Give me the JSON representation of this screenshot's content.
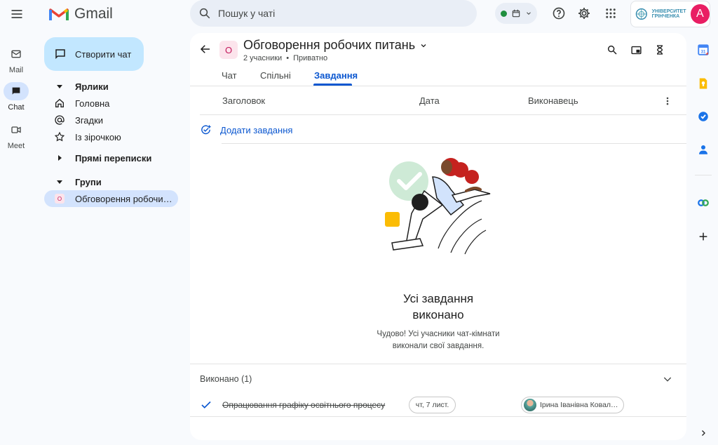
{
  "header": {
    "app_name": "Gmail",
    "search_placeholder": "Пошук у чаті",
    "account_org": "УНІВЕРСИТЕТ ГРІНЧЕНКА",
    "avatar_letter": "A",
    "status_color": "#1e8e3e"
  },
  "rail": {
    "mail": "Mail",
    "chat": "Chat",
    "meet": "Meet"
  },
  "nav": {
    "new_chat": "Створити чат",
    "labels_section": "Ярлики",
    "home": "Головна",
    "mentions": "Згадки",
    "starred": "Із зірочкою",
    "direct_section": "Прямі переписки",
    "groups_section": "Групи",
    "group_item": "Обговорення робочи…",
    "group_item_initial": "О"
  },
  "space": {
    "initial": "О",
    "title": "Обговорення робочих питань",
    "members": "2 учасники",
    "separator": "•",
    "privacy": "Приватно"
  },
  "tabs": [
    "Чат",
    "Спільні",
    "Завдання"
  ],
  "columns": {
    "title": "Заголовок",
    "date": "Дата",
    "assignee": "Виконавець"
  },
  "add_task": "Додати завдання",
  "empty_state": {
    "title_line1": "Усі завдання",
    "title_line2": "виконано",
    "text_line1": "Чудово! Усі учасники чат-кімнати",
    "text_line2": "виконали свої завдання."
  },
  "completed": {
    "header": "Виконано (1)",
    "task_title": "Опрацювання графіку освітнього процесу",
    "task_date": "чт, 7 лист.",
    "assignee": "Ірина Іванівна Ковал…"
  },
  "colors": {
    "accent": "#0b57d0",
    "compose": "#c2e7ff",
    "selected": "#d3e3fd",
    "avatar": "#e91e63"
  }
}
